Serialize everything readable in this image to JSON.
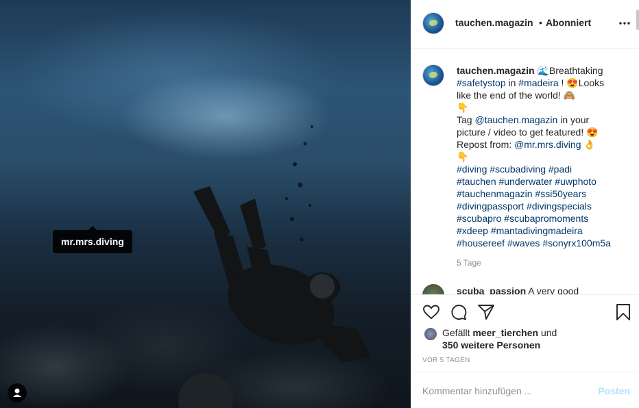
{
  "photo": {
    "tag_label": "mr.mrs.diving"
  },
  "header": {
    "username": "tauchen.magazin",
    "separator": "•",
    "follow_label": "Abonniert"
  },
  "caption": {
    "username": "tauchen.magazin",
    "lines": [
      [
        "🌊Breathtaking"
      ],
      [
        "#safetystop",
        " in ",
        "#madeira",
        " ! 😍Looks"
      ],
      [
        "like the end of the world! 🙈"
      ],
      [
        "👇"
      ],
      [
        "Tag ",
        "@tauchen.magazin",
        " in your"
      ],
      [
        "picture / video to get featured! 😍"
      ],
      [
        "Repost from: ",
        "@mr.mrs.diving",
        " 👌"
      ],
      [
        "👇"
      ],
      [
        "#diving",
        " ",
        "#scubadiving",
        " ",
        "#padi"
      ],
      [
        "#tauchen",
        " ",
        "#underwater",
        " ",
        "#uwphoto"
      ],
      [
        "#tauchenmagazin",
        " ",
        "#ssi50years"
      ],
      [
        "#divingpassport",
        " ",
        "#divingspecials"
      ],
      [
        "#scubapro",
        " ",
        "#scubapromoments"
      ],
      [
        "#xdeep",
        " ",
        "#mantadivingmadeira"
      ],
      [
        "#housereef",
        " ",
        "#waves",
        " ",
        "#sonyrx100m5a"
      ]
    ],
    "time": "5 Tage"
  },
  "next_comment": {
    "username": "scuba_passion",
    "text": "A very good"
  },
  "likes": {
    "prefix": "Gefällt ",
    "user": "meer_tierchen",
    "mid": " und",
    "count_text": "350 weitere Personen"
  },
  "posted_ago": "VOR 5 TAGEN",
  "comment_box": {
    "placeholder": "Kommentar hinzufügen ...",
    "post_label": "Posten"
  },
  "colors": {
    "link": "#00376b",
    "muted": "#8e8e8e",
    "post_disabled": "#b2dffc"
  },
  "icons": [
    "more-icon",
    "heart-icon",
    "comment-icon",
    "share-icon",
    "bookmark-icon",
    "user-tag-icon"
  ]
}
